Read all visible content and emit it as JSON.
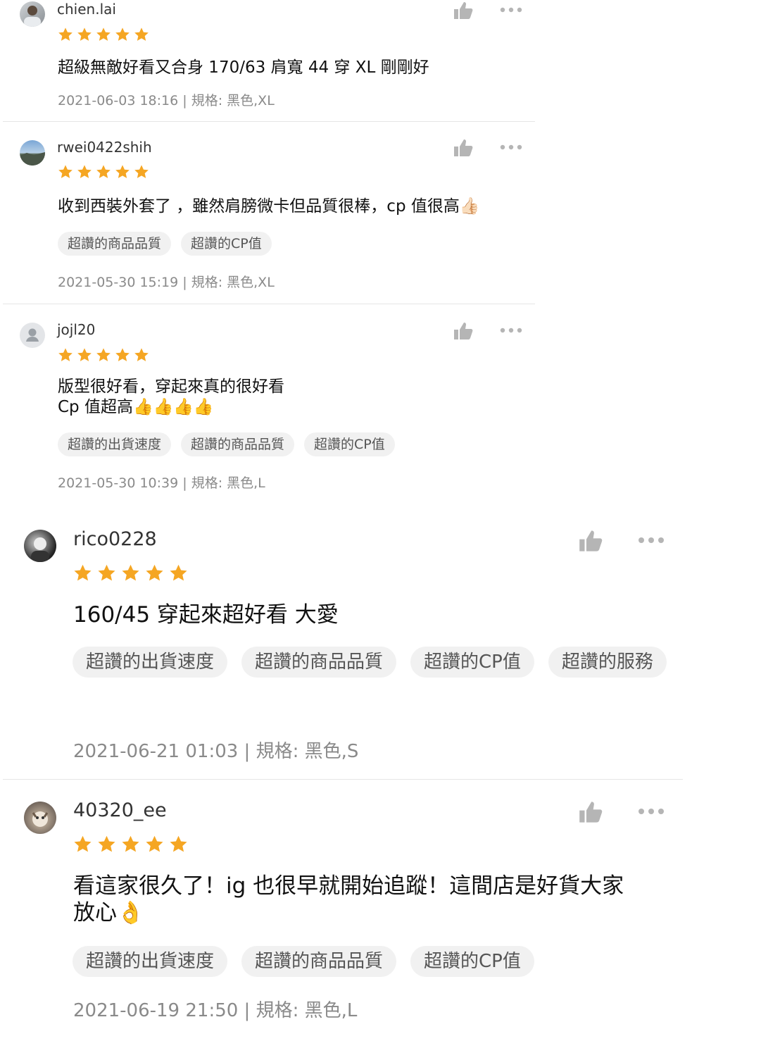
{
  "colors": {
    "star": "#F5A623",
    "icon": "#B5B5B5",
    "tag_bg": "#F1F1F1",
    "meta_text": "#8A8A8A"
  },
  "reviews": [
    {
      "username": "chien.lai",
      "avatar": "user-photo",
      "rating": 5,
      "comment_lines": [
        "超級無敵好看又合身 170/63 肩寬 44 穿 XL 剛剛好"
      ],
      "tags": [],
      "meta": "2021-06-03 18:16 | 規格: 黑色,XL"
    },
    {
      "username": "rwei0422shih",
      "avatar": "landscape-photo",
      "rating": 5,
      "comment_lines": [
        "收到西裝外套了 ，雖然肩膀微卡但品質很棒，cp 值很高👍🏻"
      ],
      "tags": [
        "超讚的商品品質",
        "超讚的CP值"
      ],
      "meta": "2021-05-30 15:19 | 規格: 黑色,XL"
    },
    {
      "username": "jojl20",
      "avatar": "default-user",
      "rating": 5,
      "comment_lines": [
        "版型很好看，穿起來真的很好看",
        "Cp 值超高👍👍👍👍"
      ],
      "tags": [
        "超讚的出貨速度",
        "超讚的商品品質",
        "超讚的CP值"
      ],
      "meta": "2021-05-30 10:39 | 規格: 黑色,L"
    },
    {
      "username": "rico0228",
      "avatar": "user-photo",
      "rating": 5,
      "comment_lines": [
        "160/45 穿起來超好看 大愛"
      ],
      "tags": [
        "超讚的出貨速度",
        "超讚的商品品質",
        "超讚的CP值",
        "超讚的服務"
      ],
      "meta": "2021-06-21 01:03 | 規格: 黑色,S"
    },
    {
      "username": "40320_ee",
      "avatar": "pet-photo",
      "rating": 5,
      "comment_lines": [
        "看這家很久了！ig 也很早就開始追蹤！這間店是好貨大家",
        "放心👌"
      ],
      "tags": [
        "超讚的出貨速度",
        "超讚的商品品質",
        "超讚的CP值"
      ],
      "meta": "2021-06-19 21:50 | 規格: 黑色,L"
    }
  ]
}
